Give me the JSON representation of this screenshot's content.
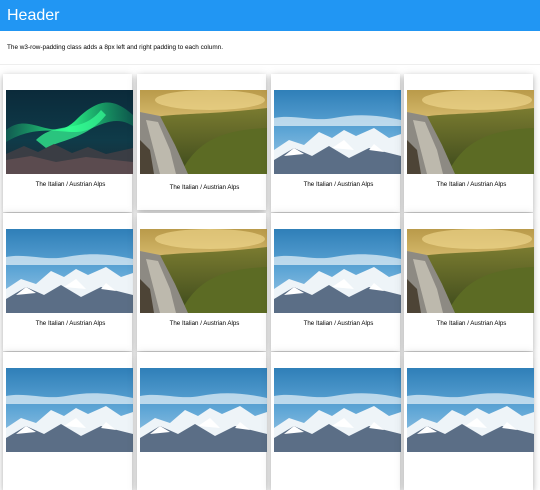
{
  "header": {
    "title": "Header"
  },
  "intro": {
    "text": "The w3-row-padding class adds a 8px left and right padding to each column."
  },
  "gallery": {
    "cards": [
      {
        "caption": "The Italian / Austrian Alps",
        "image": "aurora"
      },
      {
        "caption": "The Italian / Austrian Alps",
        "image": "valley"
      },
      {
        "caption": "The Italian / Austrian Alps",
        "image": "mountains"
      },
      {
        "caption": "The Italian / Austrian Alps",
        "image": "valley"
      },
      {
        "caption": "The Italian / Austrian Alps",
        "image": "mountains"
      },
      {
        "caption": "The Italian / Austrian Alps",
        "image": "valley"
      },
      {
        "caption": "The Italian / Austrian Alps",
        "image": "mountains"
      },
      {
        "caption": "The Italian / Austrian Alps",
        "image": "valley"
      },
      {
        "caption": "",
        "image": "mountains"
      },
      {
        "caption": "",
        "image": "mountains"
      },
      {
        "caption": "",
        "image": "mountains"
      },
      {
        "caption": "",
        "image": "mountains"
      }
    ]
  },
  "colors": {
    "header_bg": "#2196F3",
    "header_text": "#ffffff"
  }
}
